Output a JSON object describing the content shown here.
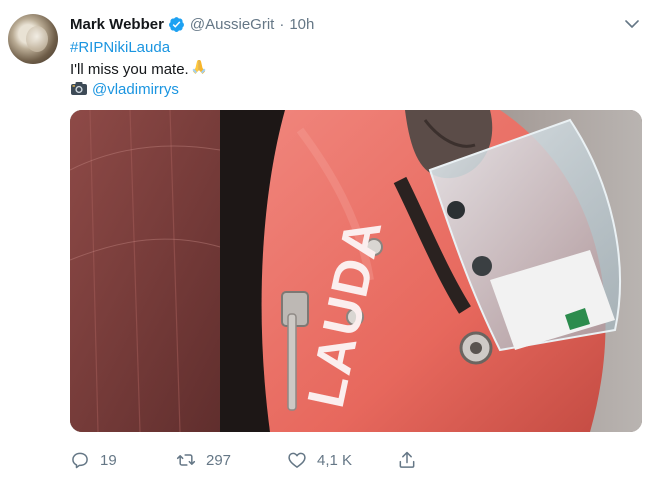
{
  "tweet": {
    "author_name": "Mark Webber",
    "handle": "@AussieGrit",
    "separator": "·",
    "time": "10h",
    "hashtag": "#RIPNikiLauda",
    "text": "I'll miss you mate.",
    "emoji": "folded-hands",
    "credit_icon": "camera-icon",
    "credit_mention": "@vladimirrys",
    "helmet_text": "LAUDA"
  },
  "actions": {
    "reply_count": "19",
    "retweet_count": "297",
    "like_count": "4,1 K"
  },
  "colors": {
    "link": "#1b95e0",
    "muted": "#657786",
    "verified": "#1da1f2"
  }
}
